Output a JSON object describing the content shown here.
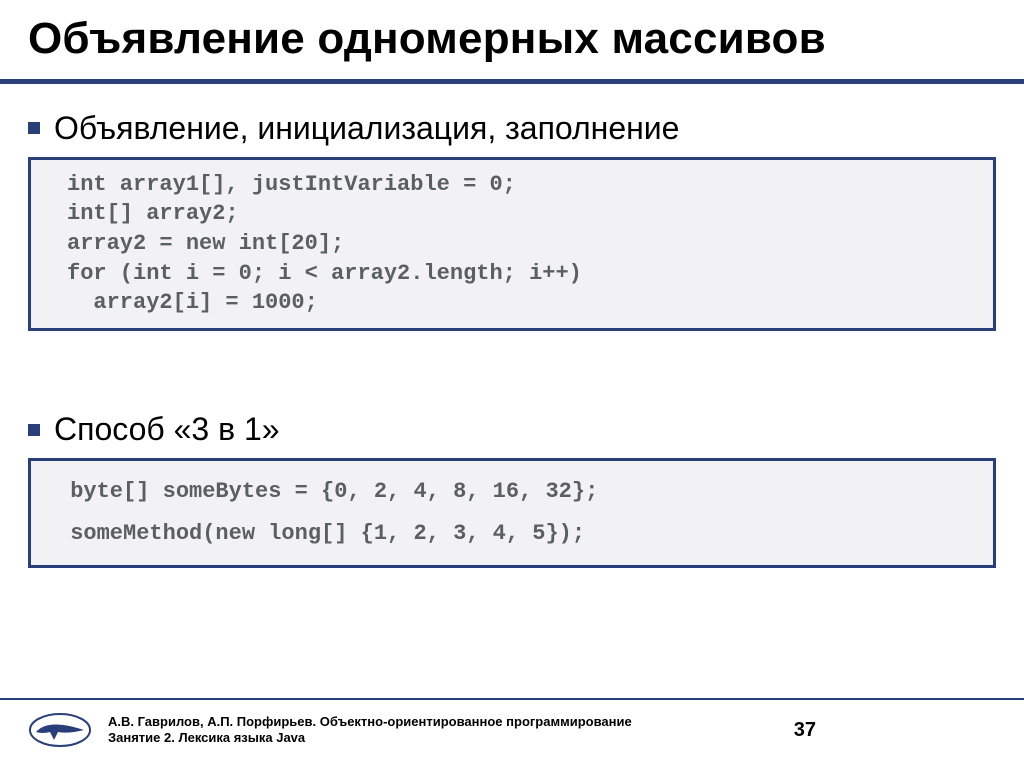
{
  "title": "Объявление одномерных массивов",
  "bullets": {
    "b1": "Объявление, инициализация, заполнение",
    "b2": "Способ «3 в 1»"
  },
  "code1": "int array1[], justIntVariable = 0;\nint[] array2;\narray2 = new int[20];\nfor (int i = 0; i < array2.length; i++)\n  array2[i] = 1000;",
  "code2": " byte[] someBytes = {0, 2, 4, 8, 16, 32};\n someMethod(new long[] {1, 2, 3, 4, 5});",
  "footer": {
    "line1": "А.В. Гаврилов, А.П. Порфирьев. Объектно-ориентированное программирование",
    "line2": "Занятие 2. Лексика языка Java"
  },
  "page_number": "37"
}
